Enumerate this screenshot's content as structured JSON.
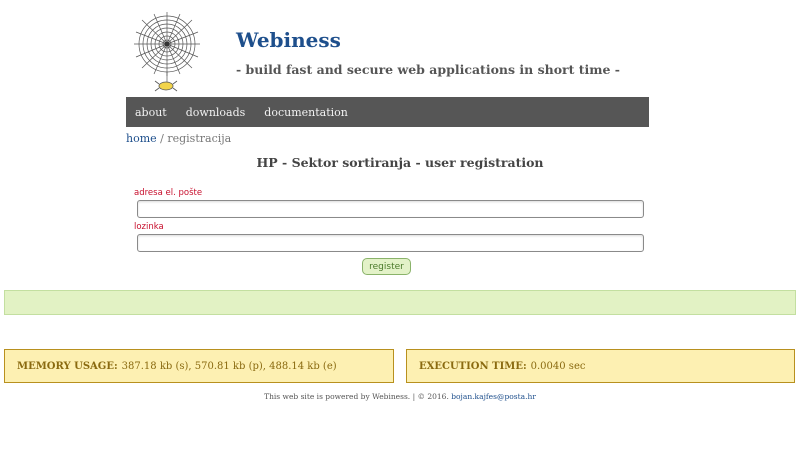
{
  "header": {
    "site_title": "Webiness",
    "tagline": "- build fast and secure web applications in short time -"
  },
  "nav": {
    "items": [
      {
        "label": "about"
      },
      {
        "label": "downloads"
      },
      {
        "label": "documentation"
      }
    ]
  },
  "breadcrumb": {
    "home": "home",
    "separator": " / ",
    "current": "registracija"
  },
  "main": {
    "title": "HP - Sektor sortiranja - user registration",
    "form": {
      "email_label": "adresa el. pošte",
      "email_value": "",
      "password_label": "lozinka",
      "password_value": "",
      "submit_label": "register"
    }
  },
  "stats": {
    "memory_label": "MEMORY USAGE:",
    "memory_value": "387.18 kb (s), 570.81 kb (p), 488.14 kb (e)",
    "exec_label": "EXECUTION TIME:",
    "exec_value": "0.0040 sec"
  },
  "footer": {
    "text": "This web site is powered by Webiness. | © 2016.",
    "email": "bojan.kajfes@posta.hr"
  },
  "colors": {
    "nav_bg": "#565656",
    "title_blue": "#1e4f8c",
    "label_red": "#c8102e",
    "message_green": "#e2f2c4",
    "stat_yellow": "#fdf0b2"
  },
  "icons": {
    "logo": "spider-web-logo-icon"
  }
}
